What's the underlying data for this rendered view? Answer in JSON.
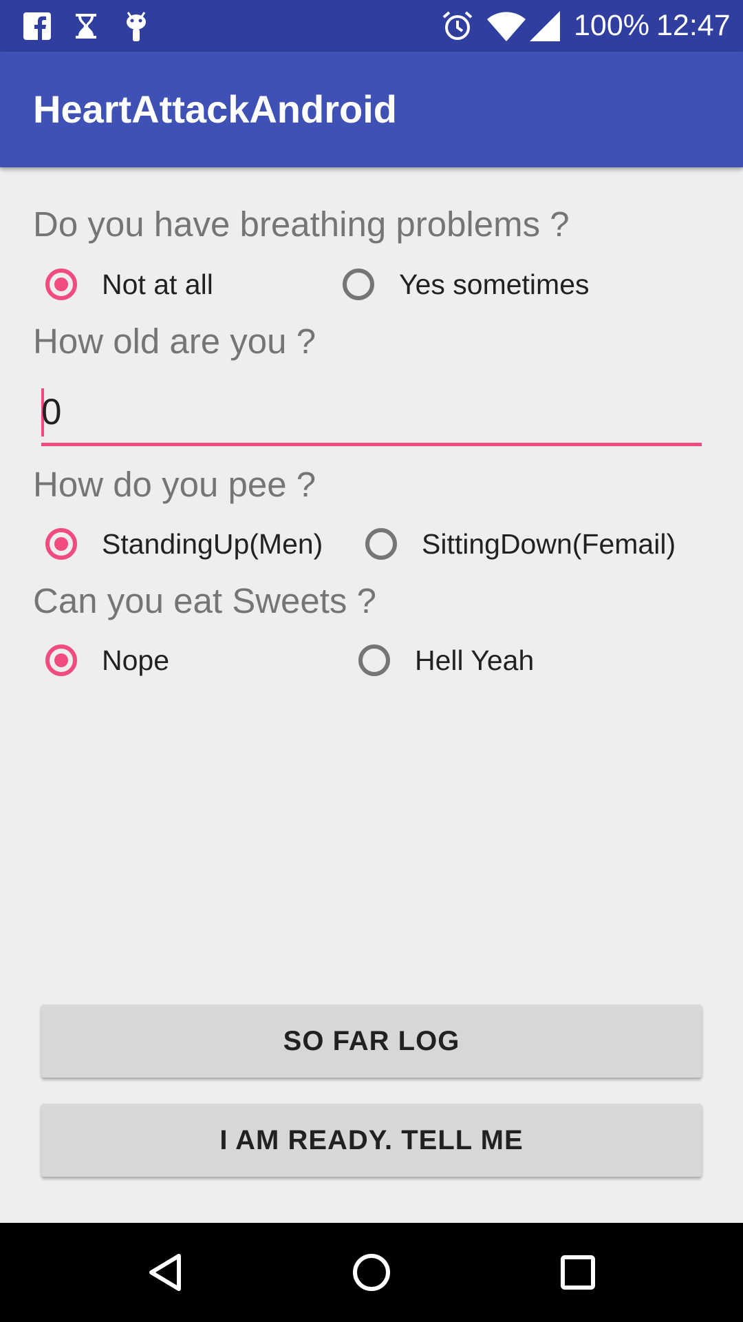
{
  "status_bar": {
    "icons_left": [
      "facebook-icon",
      "hourglass-icon",
      "android-debug-icon"
    ],
    "icons_right": [
      "alarm-icon",
      "wifi-icon",
      "signal-icon"
    ],
    "battery": "100%",
    "time": "12:47"
  },
  "app_bar": {
    "title": "HeartAttackAndroid"
  },
  "form": {
    "breathing": {
      "question": "Do you have breathing problems ?",
      "options": [
        {
          "label": "Not at all",
          "checked": true
        },
        {
          "label": "Yes sometimes",
          "checked": false
        }
      ]
    },
    "age": {
      "question": "How old are you ?",
      "value": "0"
    },
    "pee": {
      "question": "How do you pee ?",
      "options": [
        {
          "label": "StandingUp(Men)",
          "checked": true
        },
        {
          "label": "SittingDown(Femail)",
          "checked": false
        }
      ]
    },
    "sweets": {
      "question": "Can you eat Sweets ?",
      "options": [
        {
          "label": "Nope",
          "checked": true
        },
        {
          "label": "Hell Yeah",
          "checked": false
        }
      ]
    }
  },
  "buttons": {
    "log": "SO FAR LOG",
    "ready": "I AM READY. TELL ME"
  },
  "nav_bar": {
    "icons": [
      "back-icon",
      "home-icon",
      "recents-icon"
    ]
  },
  "colors": {
    "primary": "#3f51b5",
    "primary_dark": "#303f9f",
    "accent": "#f14c80",
    "background": "#eeeeee"
  }
}
